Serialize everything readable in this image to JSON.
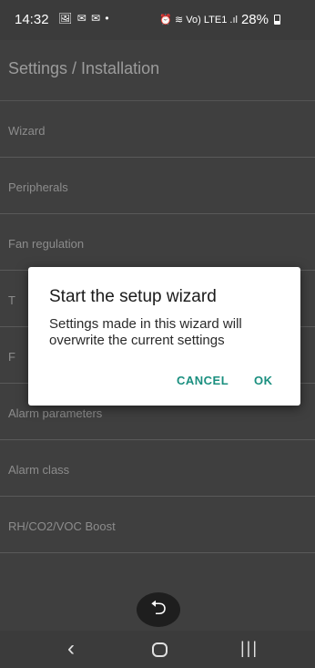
{
  "status_bar": {
    "time": "14:32",
    "left_icons": "🖼 ✉ ✉ •",
    "right_icons": "⏰ ≋ Vo) LTE1 .ıl",
    "battery": "28%"
  },
  "app_bar": {
    "title": "Settings / Installation"
  },
  "menu": {
    "items": [
      {
        "label": "Wizard"
      },
      {
        "label": "Peripherals"
      },
      {
        "label": "Fan regulation"
      },
      {
        "label": "T"
      },
      {
        "label": "F"
      },
      {
        "label": "Alarm parameters"
      },
      {
        "label": "Alarm class"
      },
      {
        "label": "RH/CO2/VOC Boost"
      }
    ]
  },
  "dialog": {
    "title": "Start the setup wizard",
    "message": "Settings made in this wizard will overwrite the current settings",
    "cancel_label": "CANCEL",
    "ok_label": "OK",
    "accent_color": "#1a8f7f"
  },
  "back_fab": {
    "icon": "back-arrow-icon",
    "glyph": "⮌"
  },
  "nav_bar": {
    "back_glyph": "‹",
    "recents_glyph": "|||"
  }
}
